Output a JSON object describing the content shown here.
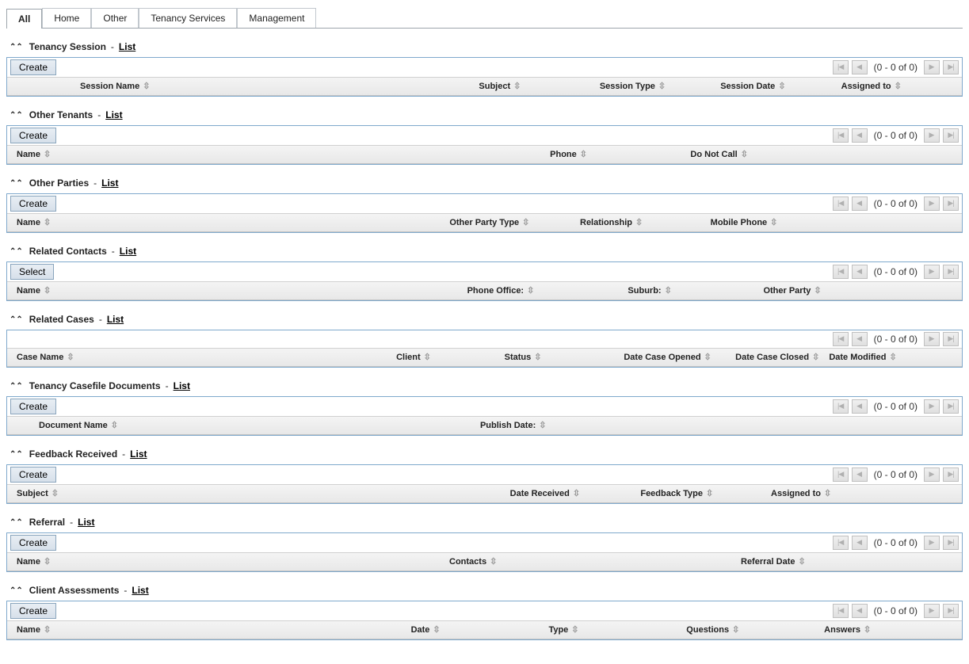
{
  "tabs": {
    "all": "All",
    "home": "Home",
    "other": "Other",
    "tenancy_services": "Tenancy Services",
    "management": "Management"
  },
  "common": {
    "create": "Create",
    "select": "Select",
    "list": "List",
    "dash": "-",
    "pager_text": "(0 - 0 of 0)"
  },
  "sections": {
    "tenancy_session": {
      "title": "Tenancy Session",
      "cols": {
        "session_name": "Session Name",
        "subject": "Subject",
        "session_type": "Session Type",
        "session_date": "Session Date",
        "assigned_to": "Assigned to"
      }
    },
    "other_tenants": {
      "title": "Other Tenants",
      "cols": {
        "name": "Name",
        "phone": "Phone",
        "do_not_call": "Do Not Call"
      }
    },
    "other_parties": {
      "title": "Other Parties",
      "cols": {
        "name": "Name",
        "other_party_type": "Other Party Type",
        "relationship": "Relationship",
        "mobile_phone": "Mobile Phone"
      }
    },
    "related_contacts": {
      "title": "Related Contacts",
      "cols": {
        "name": "Name",
        "phone_office": "Phone Office:",
        "suburb": "Suburb:",
        "other_party": "Other Party"
      }
    },
    "related_cases": {
      "title": "Related Cases",
      "cols": {
        "case_name": "Case Name",
        "client": "Client",
        "status": "Status",
        "date_case_opened": "Date Case Opened",
        "date_case_closed": "Date Case Closed",
        "date_modified": "Date Modified"
      }
    },
    "tenancy_docs": {
      "title": "Tenancy Casefile Documents",
      "cols": {
        "document_name": "Document Name",
        "publish_date": "Publish Date:"
      }
    },
    "feedback": {
      "title": "Feedback Received",
      "cols": {
        "subject": "Subject",
        "date_received": "Date Received",
        "feedback_type": "Feedback Type",
        "assigned_to": "Assigned to"
      }
    },
    "referral": {
      "title": "Referral",
      "cols": {
        "name": "Name",
        "contacts": "Contacts",
        "referral_date": "Referral Date"
      }
    },
    "client_assessments": {
      "title": "Client Assessments",
      "cols": {
        "name": "Name",
        "date": "Date",
        "type": "Type",
        "questions": "Questions",
        "answers": "Answers"
      }
    }
  }
}
